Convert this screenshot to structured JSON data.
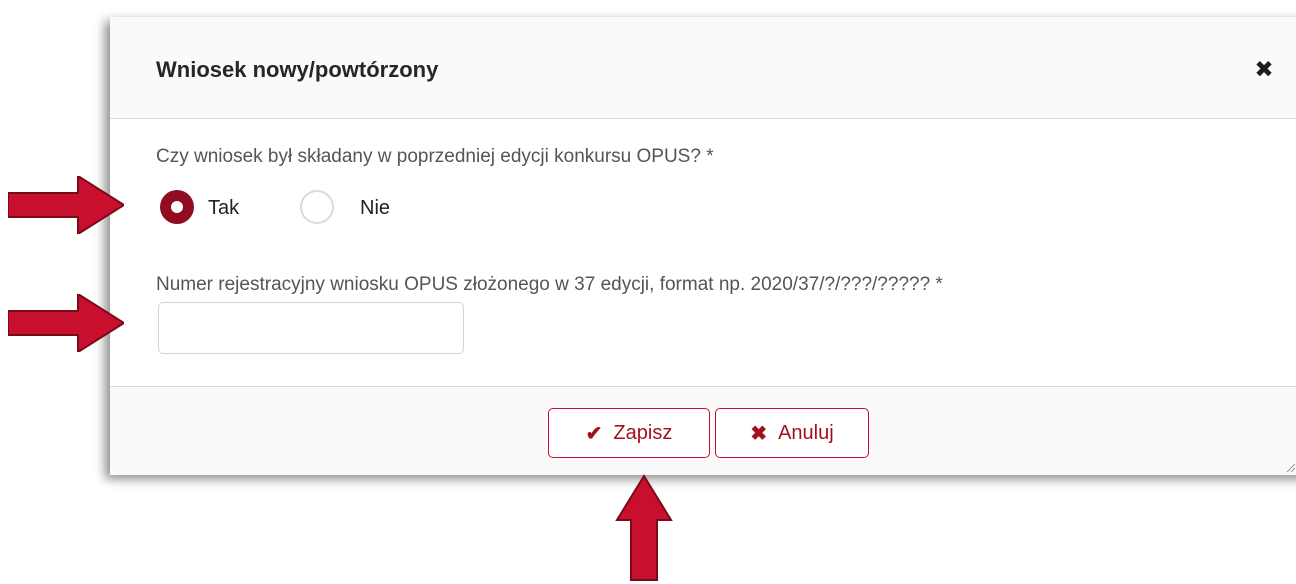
{
  "dialog": {
    "title": "Wniosek nowy/powtórzony",
    "close_icon": "close-icon"
  },
  "question": {
    "label": "Czy wniosek był składany w poprzedniej edycji konkursu OPUS? *",
    "options": [
      {
        "label": "Tak",
        "selected": true
      },
      {
        "label": "Nie",
        "selected": false
      }
    ]
  },
  "registration": {
    "label": "Numer rejestracyjny wniosku OPUS złożonego w 37 edycji, format np. 2020/37/?/???/????? *",
    "value": "",
    "placeholder": ""
  },
  "footer": {
    "save_label": "Zapisz",
    "save_icon": "check-icon",
    "cancel_label": "Anuluj",
    "cancel_icon": "times-icon"
  },
  "colors": {
    "accent": "#8f0d1f",
    "button_border": "#c8102e",
    "arrow": "#c8102e"
  }
}
